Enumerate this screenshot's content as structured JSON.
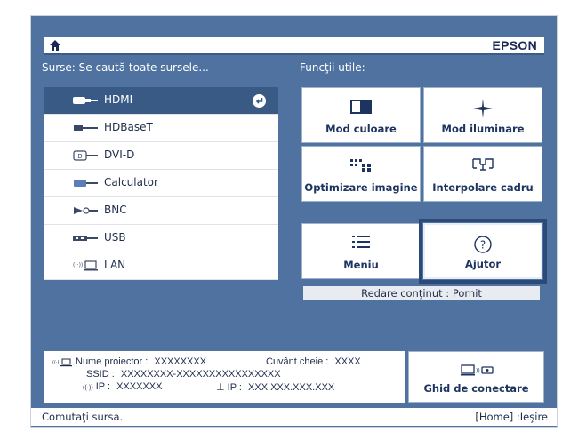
{
  "header": {
    "brand": "EPSON",
    "home_icon": "home-icon"
  },
  "sources": {
    "title": "Surse: Se caută toate sursele...",
    "items": [
      {
        "label": "HDMI",
        "icon": "hdmi-icon",
        "selected": true
      },
      {
        "label": "HDBaseT",
        "icon": "hdbaset-icon",
        "selected": false
      },
      {
        "label": "DVI-D",
        "icon": "dvi-icon",
        "selected": false
      },
      {
        "label": "Calculator",
        "icon": "computer-port-icon",
        "selected": false
      },
      {
        "label": "BNC",
        "icon": "bnc-icon",
        "selected": false
      },
      {
        "label": "USB",
        "icon": "usb-icon",
        "selected": false
      },
      {
        "label": "LAN",
        "icon": "lan-icon",
        "selected": false
      }
    ]
  },
  "functions": {
    "title": "Funcţii utile:",
    "buttons": [
      {
        "label": "Mod culoare",
        "icon": "color-mode-icon"
      },
      {
        "label": "Mod iluminare",
        "icon": "light-mode-icon"
      },
      {
        "label": "Optimizare imagine",
        "icon": "image-optimize-icon"
      },
      {
        "label": "Interpolare cadru",
        "icon": "frame-interpolation-icon"
      },
      {
        "label": "Meniu",
        "icon": "menu-icon"
      },
      {
        "label": "Ajutor",
        "icon": "help-icon"
      }
    ],
    "status": "Redare conţinut : Pornit"
  },
  "info": {
    "projector_name_label": "Nume proiector :",
    "projector_name_value": "XXXXXXXX",
    "password_label": "Cuvânt cheie :",
    "password_value": "XXXX",
    "ssid_label": "SSID :",
    "ssid_value": "XXXXXXXX-XXXXXXXXXXXXXXXX",
    "wireless_ip_label": "IP :",
    "wireless_ip_value": "XXXXXXX",
    "wired_ip_label": "IP :",
    "wired_ip_value": "XXX.XXX.XXX.XXX"
  },
  "connect": {
    "label": "Ghid de conectare",
    "icon": "connection-guide-icon"
  },
  "footer": {
    "hint": "Comutaţi sursa.",
    "exit": "[Home] :Ieşire"
  },
  "colors": {
    "background": "#4f72a0",
    "selected": "#3a5a86",
    "focus": "#2b4a78",
    "text": "#1e2c4a"
  }
}
